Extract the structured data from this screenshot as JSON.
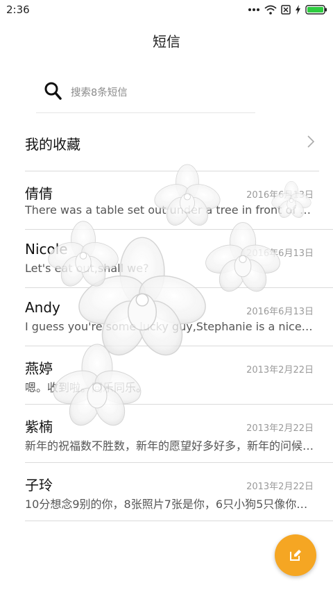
{
  "status_bar": {
    "time": "2:36",
    "icons": [
      "signal-dots-icon",
      "wifi-icon",
      "no-sim-icon",
      "charging-icon",
      "battery-icon"
    ],
    "battery_color": "#2ecc40"
  },
  "header": {
    "title": "短信"
  },
  "search": {
    "placeholder": "搜索8条短信"
  },
  "favorites": {
    "label": "我的收藏"
  },
  "conversations": [
    {
      "name": "倩倩",
      "date": "2016年6月13日",
      "preview": "There was a table set out under a tree in front of the ho…"
    },
    {
      "name": "Nicole",
      "date": "2016年6月13日",
      "preview": "Let's eat out,shall we?"
    },
    {
      "name": "Andy",
      "date": "2016年6月13日",
      "preview": "I guess you're some lucky guy,Stephanie is a nice girl."
    },
    {
      "name": "燕婷",
      "date": "2013年2月22日",
      "preview": "嗯。收到啦。同乐同乐。"
    },
    {
      "name": "紫楠",
      "date": "2013年2月22日",
      "preview": "新年的祝福数不胜数，新年的愿望好多好多，新年的问候…"
    },
    {
      "name": "子玲",
      "date": "2013年2月22日",
      "preview": "10分想念9别的你，8张照片7张是你，6只小狗5只像你，4…"
    }
  ],
  "fab": {
    "icon": "compose-icon",
    "color": "#f5a623"
  }
}
